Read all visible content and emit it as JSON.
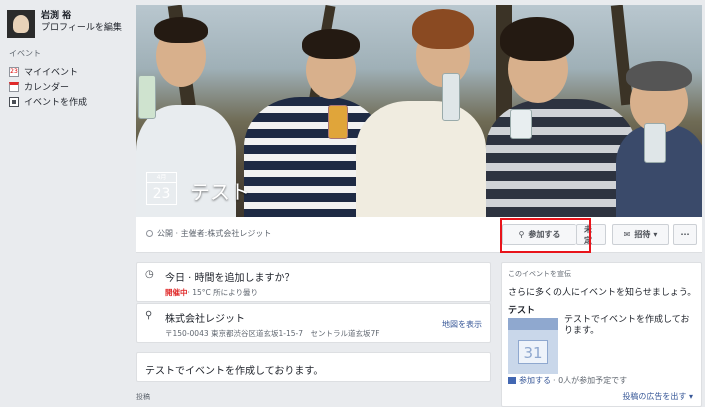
{
  "profile": {
    "name": "岩渕 裕",
    "edit": "プロフィールを編集"
  },
  "sidebar": {
    "section": "イベント",
    "items": [
      {
        "icon": "calendar-23-icon",
        "icon_text": "23",
        "label": "マイイベント"
      },
      {
        "icon": "calendar-icon",
        "label": "カレンダー"
      },
      {
        "icon": "create-event-icon",
        "label": "イベントを作成"
      }
    ]
  },
  "event": {
    "month": "4月",
    "day": "23",
    "title": "テスト",
    "privacy": "公開 · 主催者:",
    "host": "株式会社レジット"
  },
  "actions": {
    "join": "参加する",
    "undecided": "未定",
    "invite": "招待",
    "more": "···"
  },
  "details": {
    "time_main": "今日 · 時間を追加しますか？",
    "time_status": "開催中",
    "time_weather": "· 15°C 所により曇り",
    "location_name": "株式会社レジット",
    "location_address": "〒150-0043 東京都渋谷区道玄坂1-15-7　セントラル道玄坂7F",
    "map_link": "地図を表示",
    "description": "テストでイベントを作成しております。",
    "post_label": "投稿"
  },
  "promo": {
    "heading": "このイベントを宣伝",
    "description": "さらに多くの人にイベントを知らせましょう。",
    "name": "テスト",
    "cal_num": "31",
    "text": "テストでイベントを作成しております。",
    "stat_join": "参加する",
    "stat_rest": "· 0人が参加予定です",
    "cta": "投稿の広告を出す ▾"
  },
  "colors": {
    "highlight": "#e8141b",
    "link": "#385898",
    "status_red": "#e02b2b"
  }
}
